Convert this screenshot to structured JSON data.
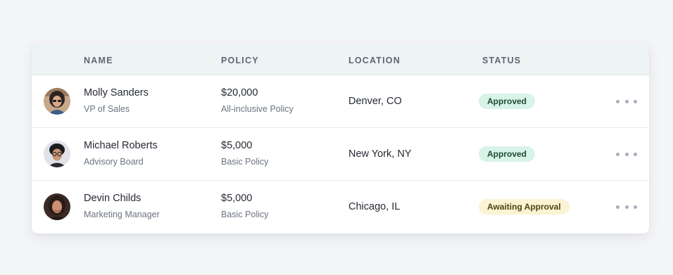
{
  "table": {
    "headers": {
      "name": "NAME",
      "policy": "POLICY",
      "location": "LOCATION",
      "status": "STATUS"
    },
    "rows": [
      {
        "name": "Molly Sanders",
        "title": "VP of Sales",
        "amount": "$20,000",
        "policy_type": "All-inclusive Policy",
        "location": "Denver, CO",
        "status": "Approved",
        "status_kind": "approved"
      },
      {
        "name": "Michael Roberts",
        "title": "Advisory Board",
        "amount": "$5,000",
        "policy_type": "Basic Policy",
        "location": "New York, NY",
        "status": "Approved",
        "status_kind": "approved"
      },
      {
        "name": "Devin Childs",
        "title": "Marketing Manager",
        "amount": "$5,000",
        "policy_type": "Basic Policy",
        "location": "Chicago, IL",
        "status": "Awaiting Approval",
        "status_kind": "awaiting"
      }
    ]
  },
  "colors": {
    "header_bg": "#eef4f3",
    "approved_bg": "#d8f3e8",
    "awaiting_bg": "#fbf3d3"
  },
  "icons": {
    "row_menu": "more-horizontal-icon"
  }
}
